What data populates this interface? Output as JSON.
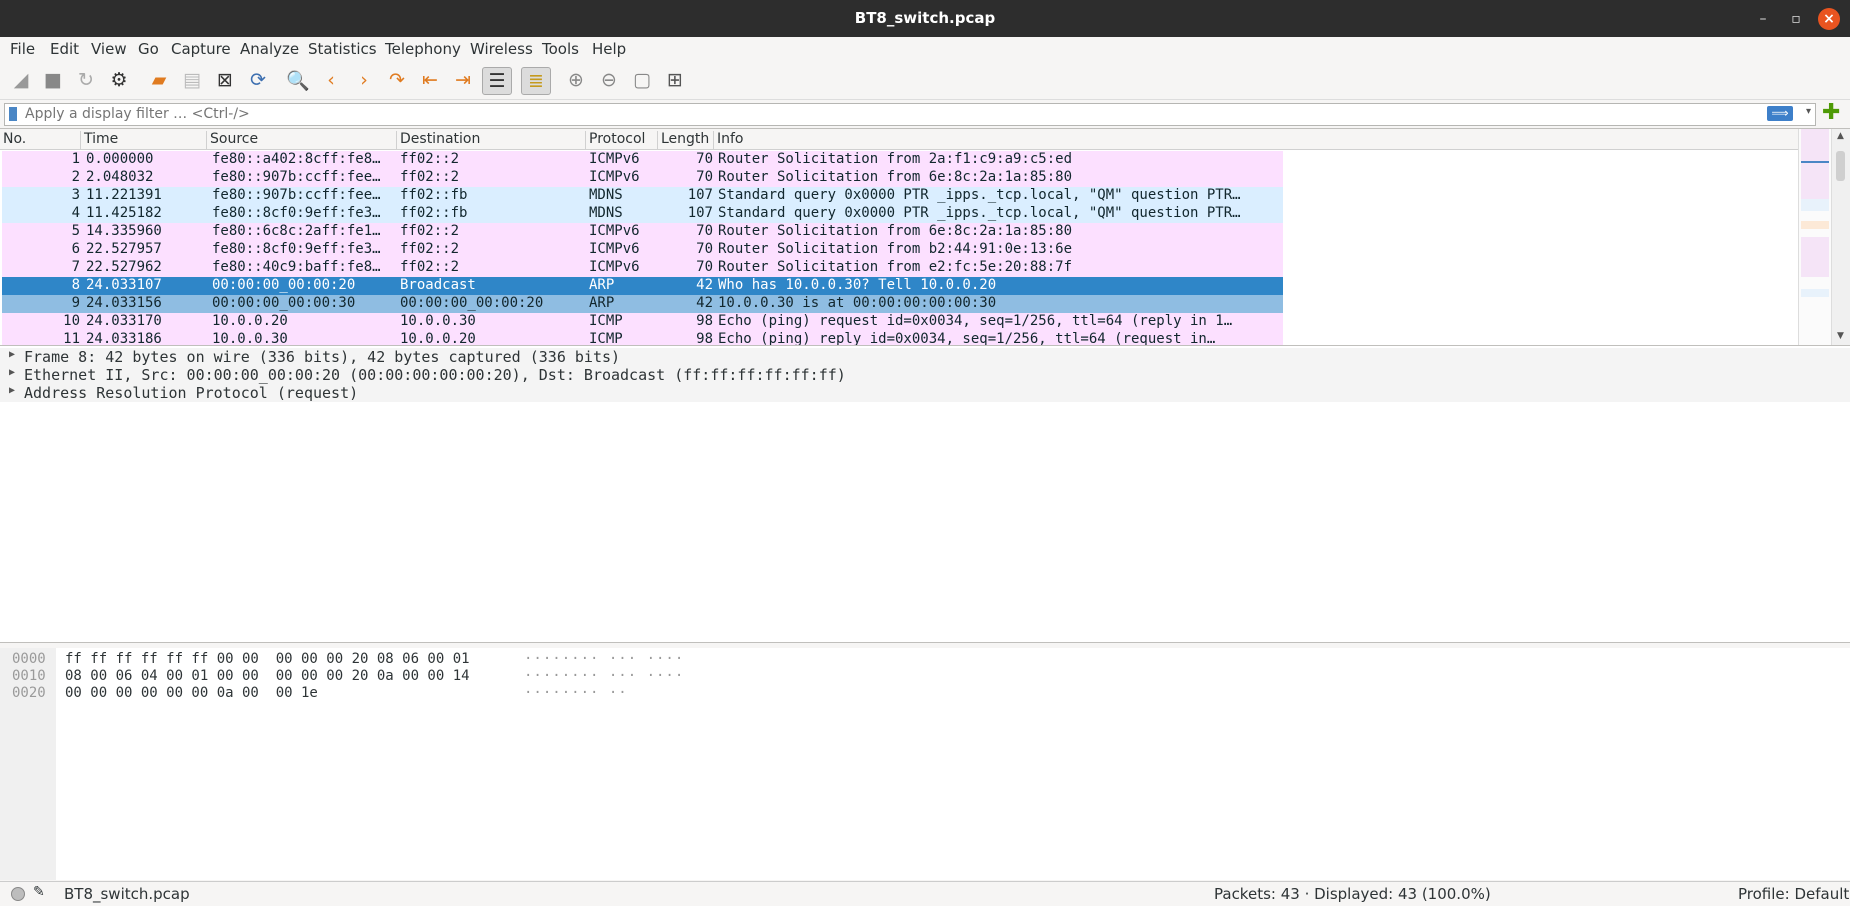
{
  "window": {
    "title": "BT8_switch.pcap"
  },
  "menu": [
    "File",
    "Edit",
    "View",
    "Go",
    "Capture",
    "Analyze",
    "Statistics",
    "Telephony",
    "Wireless",
    "Tools",
    "Help"
  ],
  "filter": {
    "placeholder": "Apply a display filter … <Ctrl-/>"
  },
  "columns": {
    "no": "No.",
    "time": "Time",
    "source": "Source",
    "destination": "Destination",
    "protocol": "Protocol",
    "length": "Length",
    "info": "Info"
  },
  "packets": [
    {
      "no": "1",
      "time": "0.000000",
      "source": "fe80::a402:8cff:fe8…",
      "destination": "ff02::2",
      "protocol": "ICMPv6",
      "length": "70",
      "info": "Router Solicitation from 2a:f1:c9:a9:c5:ed",
      "bg": "#fce0ff",
      "fg": "#12272e"
    },
    {
      "no": "2",
      "time": "2.048032",
      "source": "fe80::907b:ccff:fee…",
      "destination": "ff02::2",
      "protocol": "ICMPv6",
      "length": "70",
      "info": "Router Solicitation from 6e:8c:2a:1a:85:80",
      "bg": "#fce0ff",
      "fg": "#12272e"
    },
    {
      "no": "3",
      "time": "11.221391",
      "source": "fe80::907b:ccff:fee…",
      "destination": "ff02::fb",
      "protocol": "MDNS",
      "length": "107",
      "info": "Standard query 0x0000 PTR _ipps._tcp.local, \"QM\" question PTR…",
      "bg": "#daeeff",
      "fg": "#12272e"
    },
    {
      "no": "4",
      "time": "11.425182",
      "source": "fe80::8cf0:9eff:fe3…",
      "destination": "ff02::fb",
      "protocol": "MDNS",
      "length": "107",
      "info": "Standard query 0x0000 PTR _ipps._tcp.local, \"QM\" question PTR…",
      "bg": "#daeeff",
      "fg": "#12272e"
    },
    {
      "no": "5",
      "time": "14.335960",
      "source": "fe80::6c8c:2aff:fe1…",
      "destination": "ff02::2",
      "protocol": "ICMPv6",
      "length": "70",
      "info": "Router Solicitation from 6e:8c:2a:1a:85:80",
      "bg": "#fce0ff",
      "fg": "#12272e"
    },
    {
      "no": "6",
      "time": "22.527957",
      "source": "fe80::8cf0:9eff:fe3…",
      "destination": "ff02::2",
      "protocol": "ICMPv6",
      "length": "70",
      "info": "Router Solicitation from b2:44:91:0e:13:6e",
      "bg": "#fce0ff",
      "fg": "#12272e"
    },
    {
      "no": "7",
      "time": "22.527962",
      "source": "fe80::40c9:baff:fe8…",
      "destination": "ff02::2",
      "protocol": "ICMPv6",
      "length": "70",
      "info": "Router Solicitation from e2:fc:5e:20:88:7f",
      "bg": "#fce0ff",
      "fg": "#12272e"
    },
    {
      "no": "8",
      "time": "24.033107",
      "source": "00:00:00_00:00:20",
      "destination": "Broadcast",
      "protocol": "ARP",
      "length": "42",
      "info": "Who has 10.0.0.30? Tell 10.0.0.20",
      "bg": "#2f86c8",
      "fg": "#ffffff"
    },
    {
      "no": "9",
      "time": "24.033156",
      "source": "00:00:00_00:00:30",
      "destination": "00:00:00_00:00:20",
      "protocol": "ARP",
      "length": "42",
      "info": "10.0.0.30 is at 00:00:00:00:00:30",
      "bg": "#8fbde2",
      "fg": "#12272e"
    },
    {
      "no": "10",
      "time": "24.033170",
      "source": "10.0.0.20",
      "destination": "10.0.0.30",
      "protocol": "ICMP",
      "length": "98",
      "info": "Echo (ping) request  id=0x0034, seq=1/256, ttl=64 (reply in 1…",
      "bg": "#fce0ff",
      "fg": "#12272e"
    },
    {
      "no": "11",
      "time": "24.033186",
      "source": "10.0.0.30",
      "destination": "10.0.0.20",
      "protocol": "ICMP",
      "length": "98",
      "info": "Echo (ping) reply    id=0x0034, seq=1/256, ttl=64 (request in…",
      "bg": "#fce0ff",
      "fg": "#12272e"
    }
  ],
  "details": [
    "Frame 8: 42 bytes on wire (336 bits), 42 bytes captured (336 bits)",
    "Ethernet II, Src: 00:00:00_00:00:20 (00:00:00:00:00:20), Dst: Broadcast (ff:ff:ff:ff:ff:ff)",
    "Address Resolution Protocol (request)"
  ],
  "bytes": [
    {
      "offset": "0000",
      "hex": "ff ff ff ff ff ff 00 00  00 00 00 20 08 06 00 01",
      "ascii": "········ ··· ····"
    },
    {
      "offset": "0010",
      "hex": "08 00 06 04 00 01 00 00  00 00 00 20 0a 00 00 14",
      "ascii": "········ ··· ····"
    },
    {
      "offset": "0020",
      "hex": "00 00 00 00 00 00 0a 00  00 1e",
      "ascii": "········ ··"
    }
  ],
  "status": {
    "file": "BT8_switch.pcap",
    "packets": "Packets: 43 · Displayed: 43 (100.0%)",
    "profile": "Profile: Default"
  }
}
